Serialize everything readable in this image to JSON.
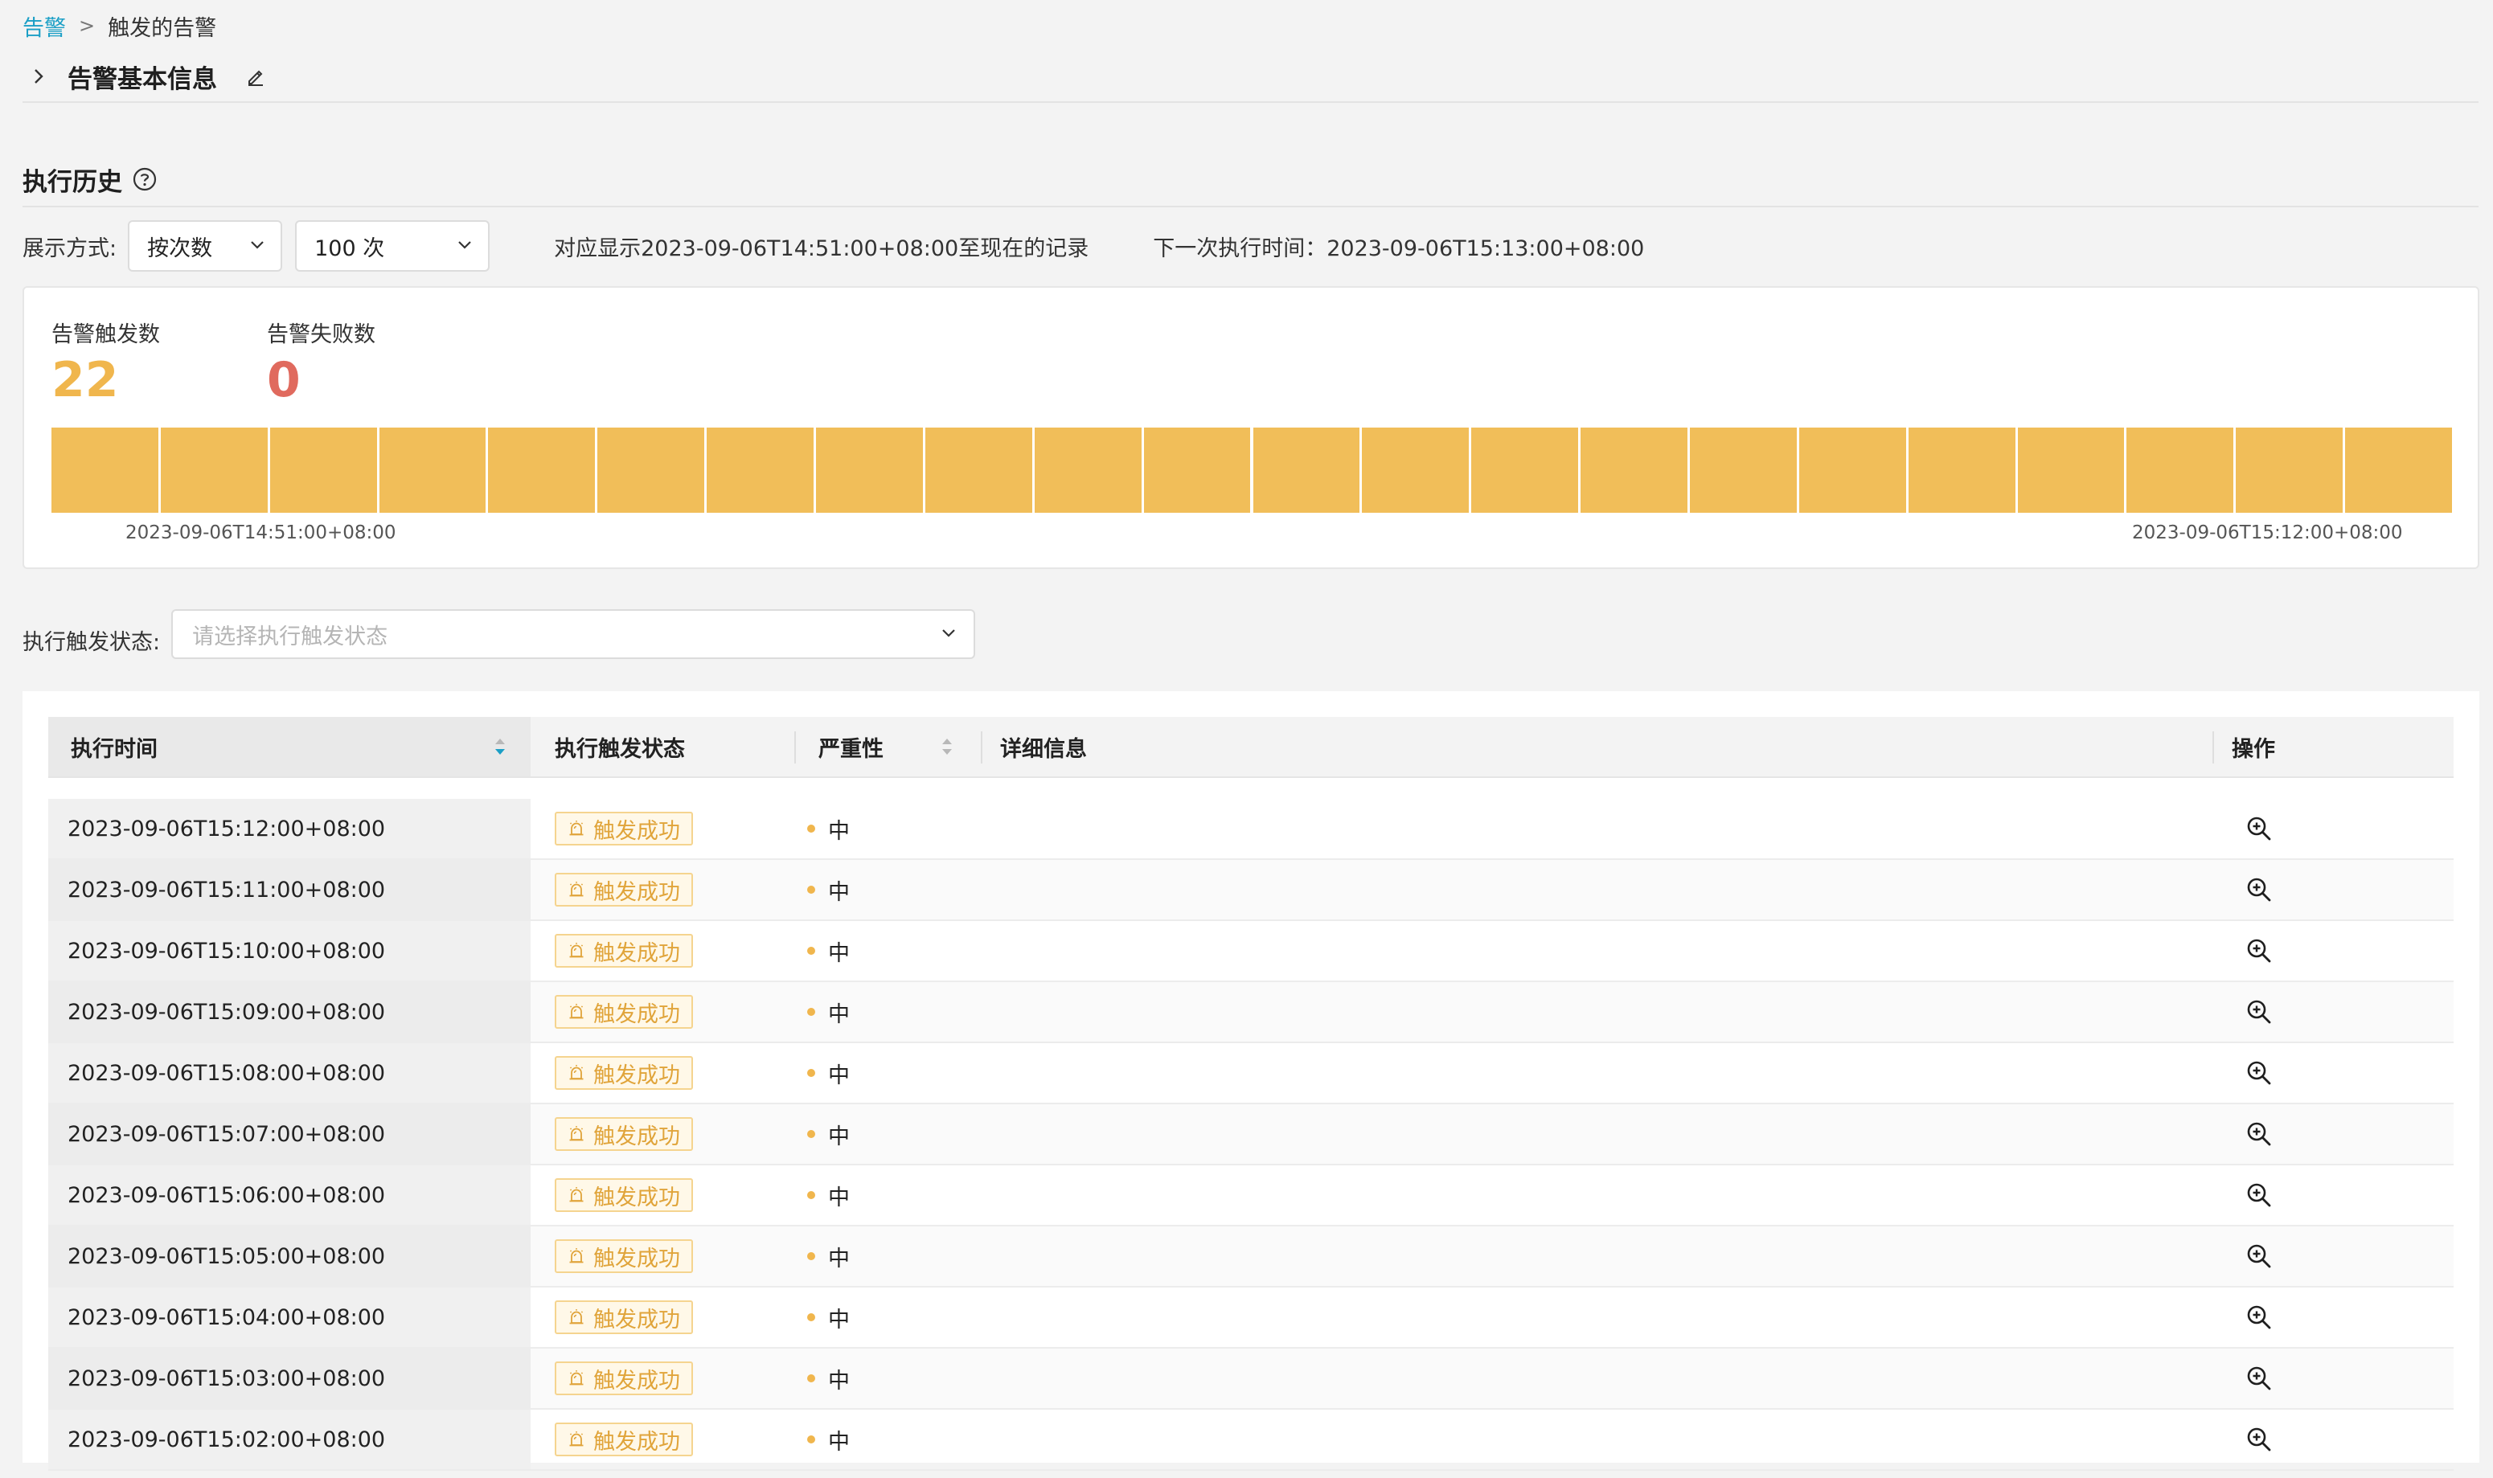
{
  "breadcrumb": {
    "parent": "告警",
    "separator": ">",
    "current": "触发的告警"
  },
  "basic_info": {
    "title": "告警基本信息"
  },
  "history": {
    "title": "执行历史",
    "display_mode_label": "展示方式:",
    "mode_value": "按次数",
    "count_value": "100 次",
    "range_text": "对应显示2023-09-06T14:51:00+08:00至现在的记录",
    "next_text": "下一次执行时间：2023-09-06T15:13:00+08:00"
  },
  "stats": {
    "trigger_label": "告警触发数",
    "trigger_value": "22",
    "fail_label": "告警失败数",
    "fail_value": "0",
    "bar_count": 22,
    "start_time": "2023-09-06T14:51:00+08:00",
    "end_time": "2023-09-06T15:12:00+08:00"
  },
  "filter": {
    "label": "执行触发状态:",
    "placeholder": "请选择执行触发状态"
  },
  "table": {
    "columns": {
      "time": "执行时间",
      "status": "执行触发状态",
      "severity": "严重性",
      "detail": "详细信息",
      "op": "操作"
    },
    "rows": [
      {
        "time": "2023-09-06T15:12:00+08:00",
        "status": "触发成功",
        "severity": "中"
      },
      {
        "time": "2023-09-06T15:11:00+08:00",
        "status": "触发成功",
        "severity": "中"
      },
      {
        "time": "2023-09-06T15:10:00+08:00",
        "status": "触发成功",
        "severity": "中"
      },
      {
        "time": "2023-09-06T15:09:00+08:00",
        "status": "触发成功",
        "severity": "中"
      },
      {
        "time": "2023-09-06T15:08:00+08:00",
        "status": "触发成功",
        "severity": "中"
      },
      {
        "time": "2023-09-06T15:07:00+08:00",
        "status": "触发成功",
        "severity": "中"
      },
      {
        "time": "2023-09-06T15:06:00+08:00",
        "status": "触发成功",
        "severity": "中"
      },
      {
        "time": "2023-09-06T15:05:00+08:00",
        "status": "触发成功",
        "severity": "中"
      },
      {
        "time": "2023-09-06T15:04:00+08:00",
        "status": "触发成功",
        "severity": "中"
      },
      {
        "time": "2023-09-06T15:03:00+08:00",
        "status": "触发成功",
        "severity": "中"
      },
      {
        "time": "2023-09-06T15:02:00+08:00",
        "status": "触发成功",
        "severity": "中"
      }
    ]
  },
  "colors": {
    "accent_link": "#1b9fc6",
    "trigger": "#f0b64d",
    "bar": "#f1be59",
    "fail": "#e06a5e"
  },
  "icons": {
    "collapse": "chevron-right-icon",
    "edit": "edit-pencil-icon",
    "help": "question-circle-icon",
    "dropdown": "chevron-down-icon",
    "sort": "sort-icon",
    "alarm": "alarm-icon",
    "detail": "zoom-in-icon"
  }
}
